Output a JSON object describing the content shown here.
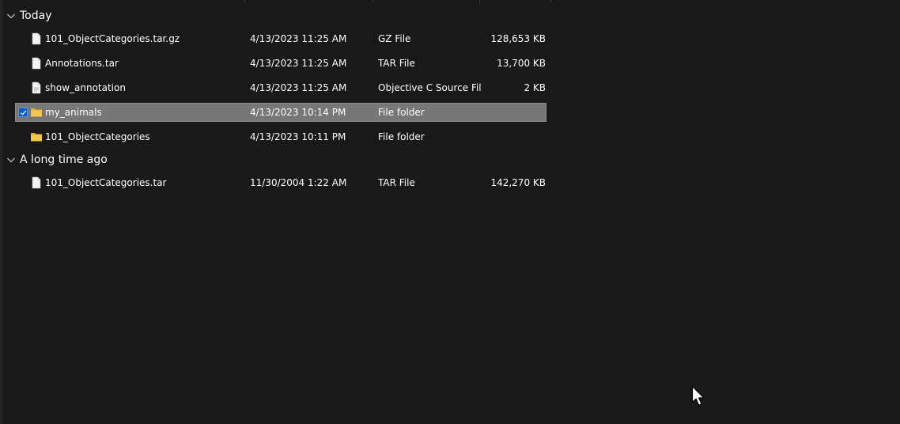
{
  "groups": [
    {
      "label": "Today",
      "files": [
        {
          "name": "101_ObjectCategories.tar.gz",
          "date": "4/13/2023 11:25 AM",
          "type": "GZ File",
          "size": "128,653 KB",
          "icon": "file-icon"
        },
        {
          "name": "Annotations.tar",
          "date": "4/13/2023 11:25 AM",
          "type": "TAR File",
          "size": "13,700 KB",
          "icon": "file-icon"
        },
        {
          "name": "show_annotation",
          "date": "4/13/2023 11:25 AM",
          "type": "Objective C Source File",
          "size": "2 KB",
          "icon": "file-icon"
        },
        {
          "name": "my_animals",
          "date": "4/13/2023 10:14 PM",
          "type": "File folder",
          "size": "",
          "icon": "folder-icon",
          "selected": true
        },
        {
          "name": "101_ObjectCategories",
          "date": "4/13/2023 10:11 PM",
          "type": "File folder",
          "size": "",
          "icon": "folder-icon"
        }
      ]
    },
    {
      "label": "A long time ago",
      "files": [
        {
          "name": "101_ObjectCategories.tar",
          "date": "11/30/2004 1:22 AM",
          "type": "TAR File",
          "size": "142,270 KB",
          "icon": "file-icon"
        }
      ]
    }
  ],
  "colors": {
    "background": "#191919",
    "selection": "#777777",
    "checkbox": "#0b5cc1",
    "folder": "#f3c64e"
  }
}
